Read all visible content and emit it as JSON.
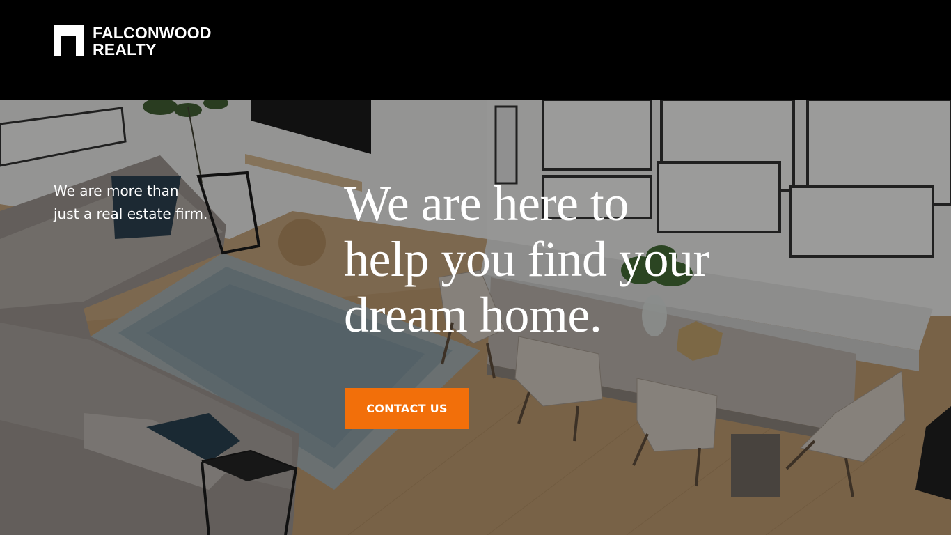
{
  "brand": {
    "name_line1": "FALCONWOOD",
    "name_line2": "REALTY",
    "accent_color": "#f26f0a"
  },
  "hero": {
    "tagline_line1": "We are more than",
    "tagline_line2": "just a real estate firm.",
    "headline_line1": "We are here to",
    "headline_line2": "help you find your",
    "headline_line3": "dream home.",
    "cta_label": "CONTACT US",
    "background_image": "living-room-interior-photo"
  }
}
